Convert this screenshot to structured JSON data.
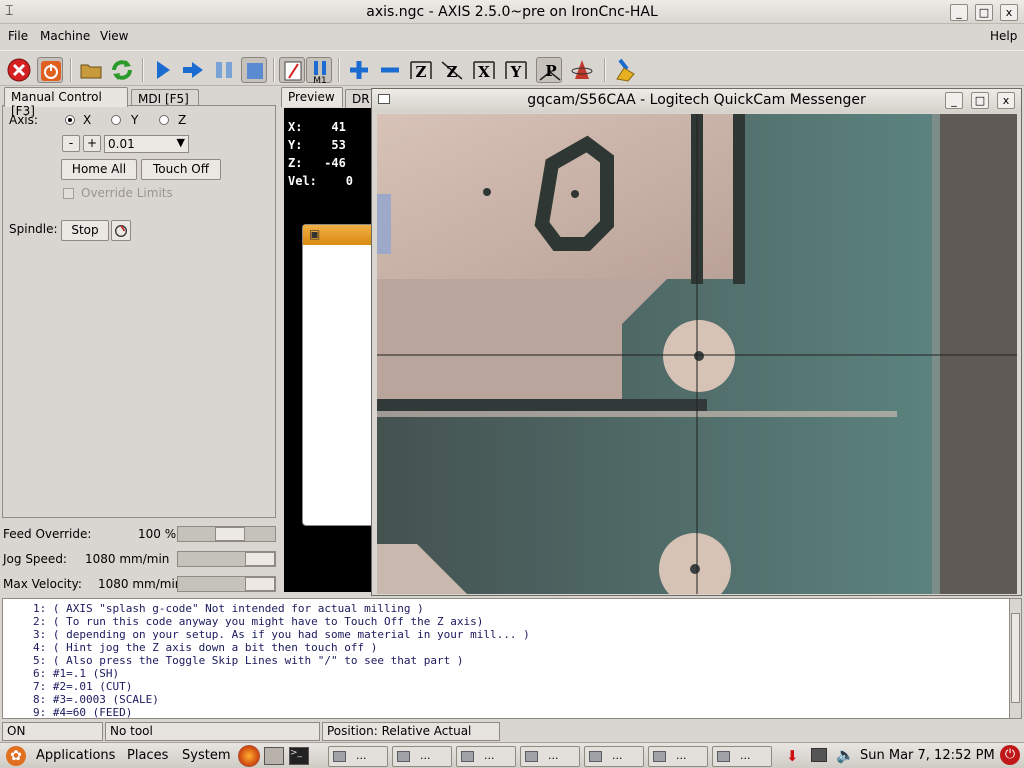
{
  "window": {
    "title": "axis.ngc - AXIS 2.5.0~pre on IronCnc-HAL",
    "minimize": "_",
    "maximize": "□",
    "close": "x"
  },
  "menu": {
    "file": "File",
    "machine": "Machine",
    "view": "View",
    "help": "Help"
  },
  "toolbar": {
    "icons": [
      "estop-icon",
      "power-icon",
      "open-icon",
      "reload-icon",
      "run-icon",
      "step-icon",
      "pause-icon",
      "stop-icon",
      "block-delete-icon",
      "optional-stop-icon",
      "zoom-in-icon",
      "zoom-out-icon",
      "view-z-icon",
      "view-z2-icon",
      "view-x-icon",
      "view-y-icon",
      "view-p-icon",
      "rotate-icon",
      "clear-plot-icon"
    ],
    "labels": {
      "z": "Z",
      "z2": "Z",
      "x": "X",
      "y": "Y",
      "p": "P",
      "m1": "M1"
    }
  },
  "tabs": {
    "manual": "Manual Control [F3]",
    "mdi": "MDI [F5]",
    "preview": "Preview",
    "dro": "DR"
  },
  "manual": {
    "axis_label": "Axis:",
    "axes": [
      "X",
      "Y",
      "Z"
    ],
    "selected_axis": "X",
    "minus": "-",
    "plus": "+",
    "increment": "0.01",
    "home_all": "Home All",
    "touch_off": "Touch Off",
    "override_limits": "Override Limits",
    "spindle_label": "Spindle:",
    "spindle_stop": "Stop"
  },
  "overrides": {
    "feed_label": "Feed Override:",
    "feed_value": "100 %",
    "feed_level": 0.55,
    "jog_label": "Jog Speed:",
    "jog_value": "1080 mm/min",
    "jog_level": 1.0,
    "maxvel_label": "Max Velocity:",
    "maxvel_value": "1080 mm/min",
    "maxvel_level": 1.0
  },
  "dro": {
    "x": "X:    41",
    "y": "Y:    53",
    "z": "Z:   -46",
    "vel": "Vel:    0"
  },
  "camera": {
    "title": "gqcam/S56CAA - Logitech QuickCam Messenger"
  },
  "gcode": [
    "1: ( AXIS \"splash g-code\" Not intended for actual milling )",
    "2: ( To run this code anyway you might have to Touch Off the Z axis)",
    "3: ( depending on your setup. As if you had some material in your mill... )",
    "4: ( Hint jog the Z axis down a bit then touch off )",
    "5: ( Also press the Toggle Skip Lines with \"/\" to see that part )",
    "6: #1=.1 (SH)",
    "7: #2=.01 (CUT)",
    "8: #3=.0003 (SCALE)",
    "9: #4=60 (FEED)"
  ],
  "status": {
    "state": "ON",
    "tool": "No tool",
    "position": "Position: Relative Actual"
  },
  "taskbar": {
    "applications": "Applications",
    "places": "Places",
    "system": "System",
    "task_label": "...",
    "clock": "Sun Mar  7, 12:52 PM"
  },
  "colors": {
    "accent": "#f0a020",
    "estop": "#d42020",
    "toolbar_blue": "#1a6cd0"
  }
}
